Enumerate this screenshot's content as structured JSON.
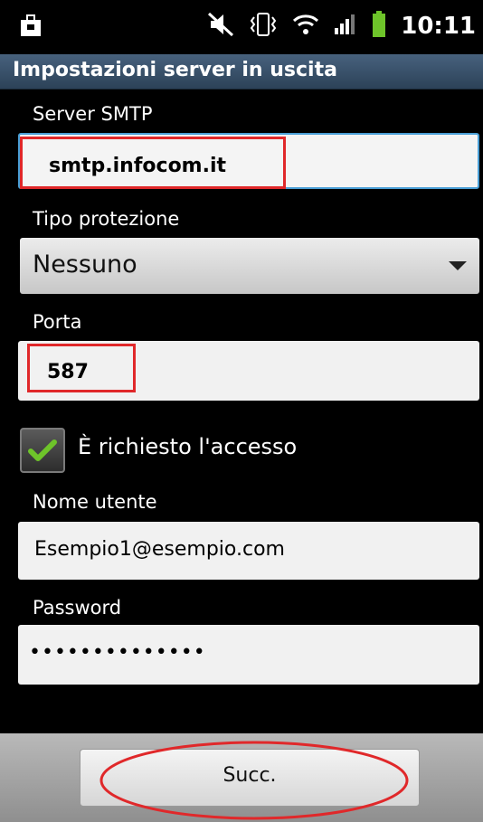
{
  "status_bar": {
    "time": "10:11",
    "icons": [
      "briefcase-icon",
      "mute-icon",
      "vibrate-icon",
      "wifi-icon",
      "signal-icon",
      "battery-icon"
    ]
  },
  "header": {
    "title": "Impostazioni server in uscita"
  },
  "form": {
    "smtp_label": "Server SMTP",
    "smtp_value": "smtp.infocom.it",
    "protection_label": "Tipo protezione",
    "protection_value": "Nessuno",
    "port_label": "Porta",
    "port_value": "587",
    "login_required_label": "È richiesto l'accesso",
    "login_required_checked": true,
    "username_label": "Nome utente",
    "username_value": "Esempio1@esempio.com",
    "password_label": "Password",
    "password_value": "••••••••••••••"
  },
  "footer": {
    "next_label": "Succ."
  },
  "colors": {
    "highlight": "#e0282a",
    "accent": "#4a9fd6",
    "check": "#6ec42a"
  }
}
